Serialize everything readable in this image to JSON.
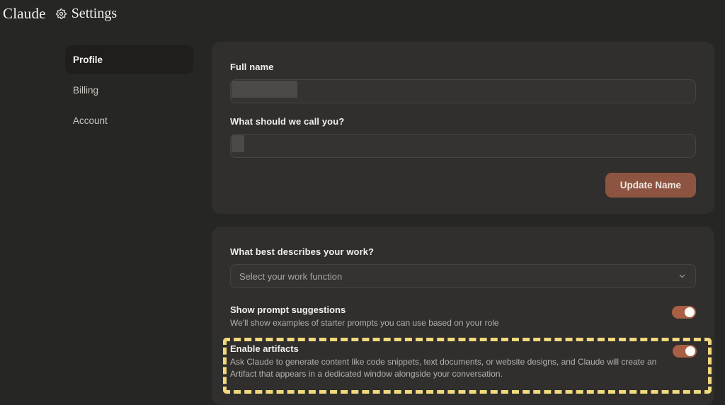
{
  "header": {
    "brand": "Claude",
    "settings_label": "Settings",
    "gear_icon": "gear-icon"
  },
  "sidebar": {
    "items": [
      {
        "label": "Profile",
        "active": true
      },
      {
        "label": "Billing",
        "active": false
      },
      {
        "label": "Account",
        "active": false
      }
    ]
  },
  "profile_card": {
    "full_name": {
      "label": "Full name",
      "value": "",
      "placeholder": "",
      "redacted": true
    },
    "nickname": {
      "label": "What should we call you?",
      "value": "",
      "placeholder": "",
      "redacted": true
    },
    "update_button": "Update Name"
  },
  "preferences_card": {
    "work_function": {
      "label": "What best describes your work?",
      "selected": "Select your work function",
      "chevron_icon": "chevron-down-icon"
    },
    "toggles": [
      {
        "title": "Show prompt suggestions",
        "description": "We'll show examples of starter prompts you can use based on your role",
        "state": "on"
      },
      {
        "title": "Enable artifacts",
        "description": "Ask Claude to generate content like code snippets, text documents, or website designs, and Claude will create an Artifact that appears in a dedicated window alongside your conversation.",
        "state": "on"
      }
    ]
  },
  "annotation": {
    "highlight_color": "#f2d97d",
    "highlight_target": "Enable artifacts"
  },
  "colors": {
    "page_background": "#262624",
    "card_background": "#302f2d",
    "accent": "#8d5541",
    "toggle_on": "#a85f43",
    "highlight": "#f2d97d"
  }
}
